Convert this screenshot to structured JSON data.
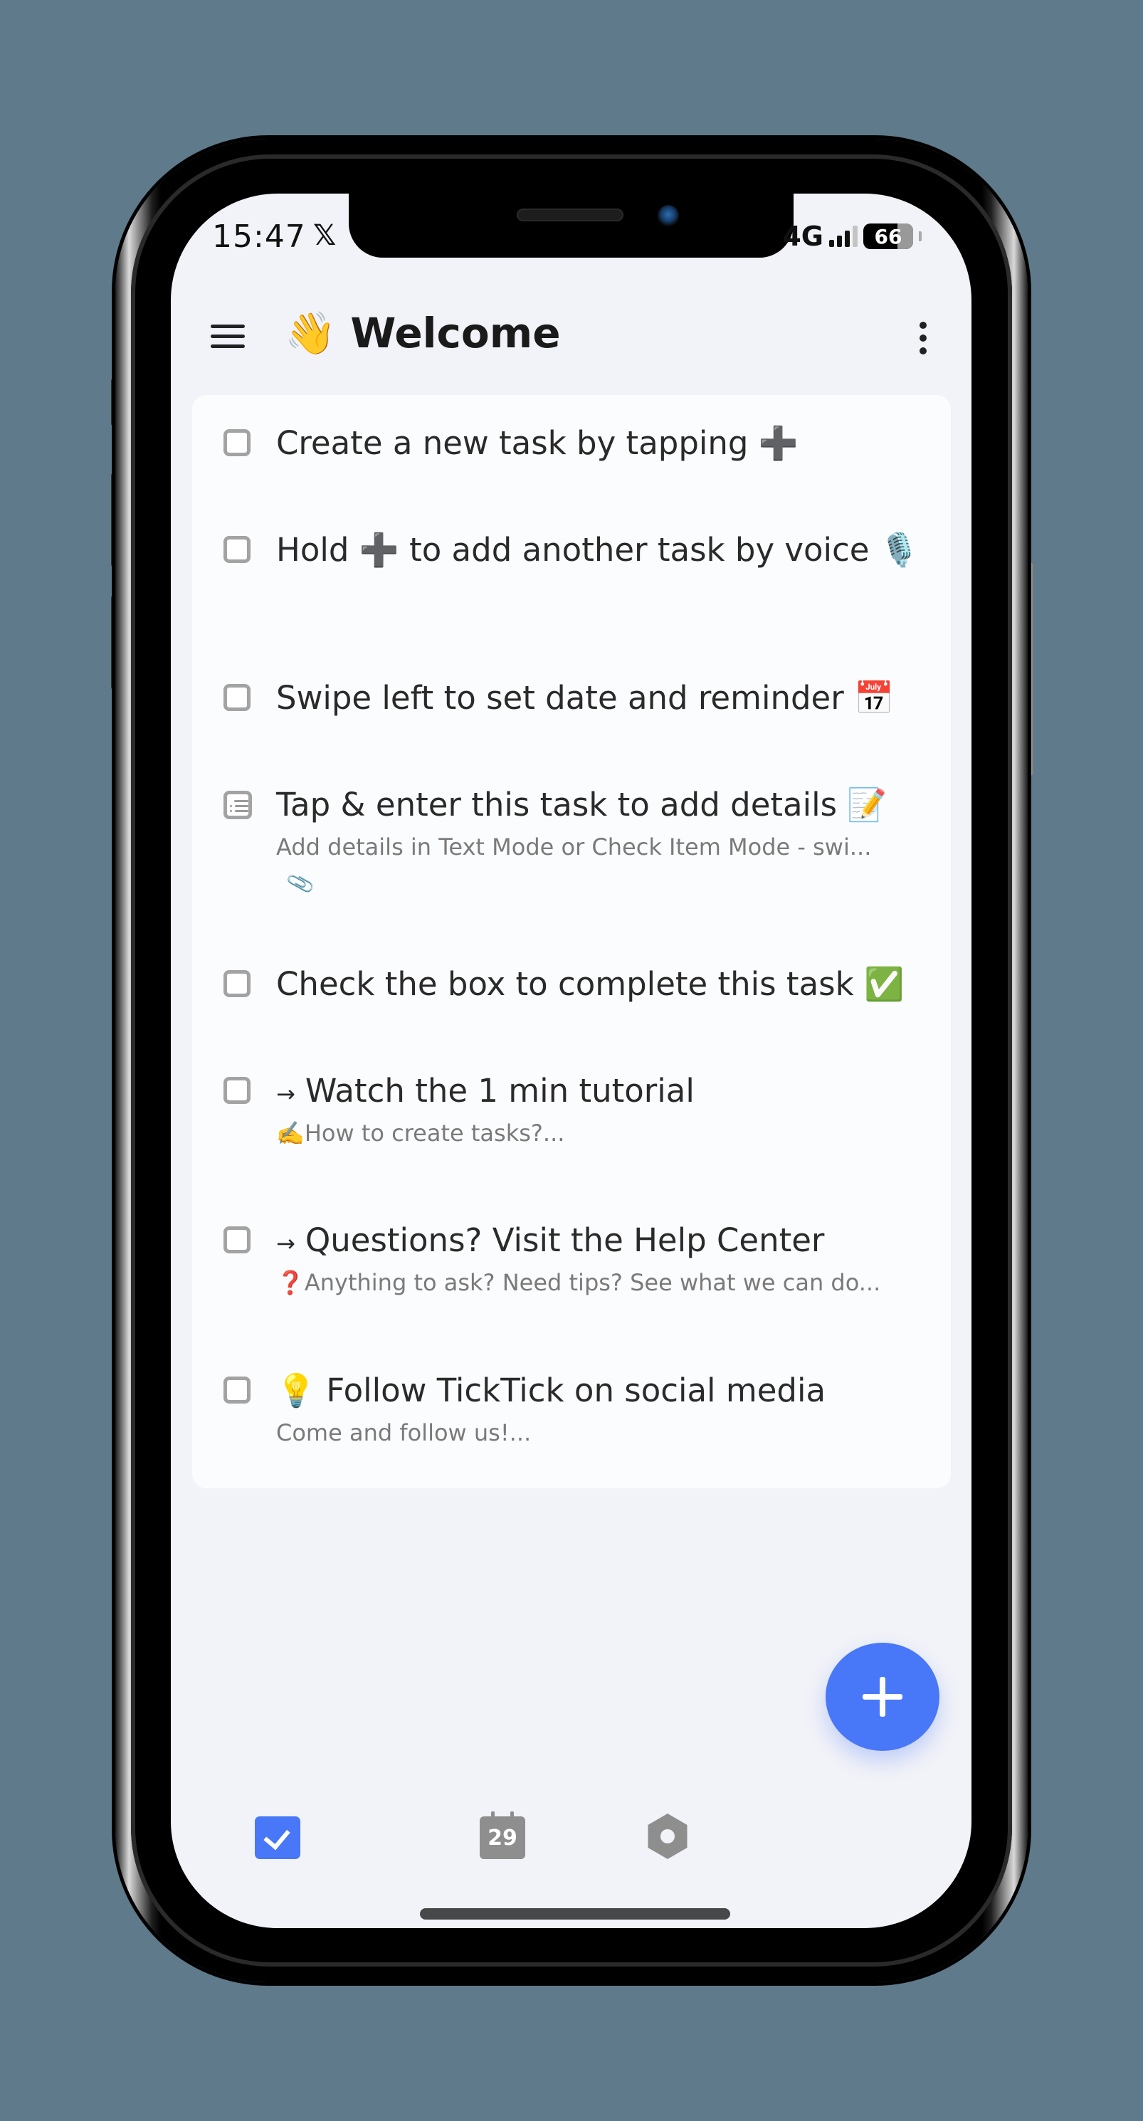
{
  "status_bar": {
    "time": "15:47",
    "app_notification_icon": "x-logo-icon",
    "network": "4G",
    "signal_bars": 3,
    "battery_percent": "66"
  },
  "header": {
    "emoji": "👋",
    "title": "Welcome",
    "menu_icon": "hamburger-menu-icon",
    "more_icon": "more-vertical-icon"
  },
  "tasks": [
    {
      "title": "Create a new task by tapping ➕",
      "type": "checkbox",
      "subtitle": null
    },
    {
      "title": "Hold ➕ to add another task by voice 🎙️",
      "type": "checkbox",
      "subtitle": null
    },
    {
      "title": "Swipe left to set date and reminder 📅",
      "type": "checkbox",
      "subtitle": null
    },
    {
      "title": "Tap & enter this task to add details 📝",
      "type": "note",
      "subtitle": "Add details in Text Mode or Check Item Mode - swi...",
      "has_attachment": true
    },
    {
      "title": "Check the box to complete this task ✅",
      "type": "checkbox",
      "subtitle": null
    },
    {
      "title": "Watch the 1 min tutorial",
      "prefix": "→",
      "type": "checkbox",
      "subtitle": "✍️How to create tasks?..."
    },
    {
      "title": "Questions? Visit the Help Center",
      "prefix": "→",
      "type": "checkbox",
      "subtitle": "❓Anything to ask? Need tips? See what we can do..."
    },
    {
      "title": "💡 Follow TickTick on social media",
      "type": "checkbox",
      "subtitle": "Come and follow us!..."
    }
  ],
  "fab": {
    "icon": "plus-icon",
    "label": "Add task"
  },
  "bottom_nav": {
    "items": [
      {
        "name": "tasks",
        "icon": "checkbox-icon",
        "active": true
      },
      {
        "name": "calendar",
        "icon": "calendar-icon",
        "date": "29",
        "active": false
      },
      {
        "name": "settings",
        "icon": "settings-icon",
        "active": false
      }
    ]
  },
  "colors": {
    "accent": "#4877f7",
    "background": "#f2f3f8",
    "card": "#fbfcfe",
    "inactive_icon": "#8e8e8e",
    "page_background": "#5f7a8a"
  }
}
